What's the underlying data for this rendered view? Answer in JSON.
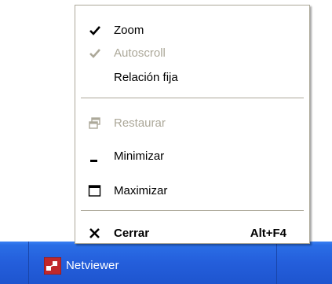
{
  "colors": {
    "menu_border": "#aca899",
    "disabled_text": "#aca899",
    "taskbar_blue": "#245edb",
    "icon_red": "#c0282b"
  },
  "menu": {
    "zoom": {
      "label": "Zoom",
      "checked": true,
      "enabled": true,
      "icon": "checkmark-icon"
    },
    "autoscroll": {
      "label": "Autoscroll",
      "checked": true,
      "enabled": false,
      "icon": "checkmark-icon"
    },
    "fixed_ratio": {
      "label": "Relación fija",
      "checked": false,
      "enabled": true
    },
    "restore": {
      "label": "Restaurar",
      "enabled": false,
      "icon": "restore-icon"
    },
    "minimize": {
      "label": "Minimizar",
      "enabled": true,
      "icon": "minimize-icon"
    },
    "maximize": {
      "label": "Maximizar",
      "enabled": true,
      "icon": "maximize-icon"
    },
    "close": {
      "label": "Cerrar",
      "shortcut": "Alt+F4",
      "enabled": true,
      "icon": "close-icon"
    }
  },
  "taskbar": {
    "app_label": "Netviewer",
    "app_icon": "netviewer-app-icon"
  }
}
